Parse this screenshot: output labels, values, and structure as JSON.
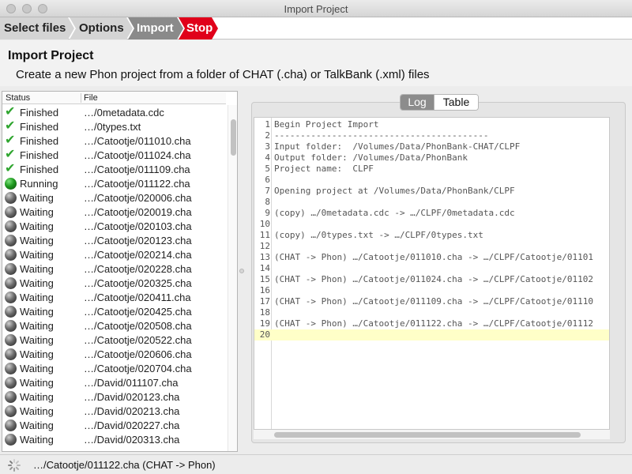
{
  "window": {
    "title": "Import Project"
  },
  "steps": [
    {
      "label": "Select files"
    },
    {
      "label": "Options"
    },
    {
      "label": "Import"
    },
    {
      "label": "Stop"
    }
  ],
  "header": {
    "title": "Import Project",
    "description": "Create a new Phon project from a folder of CHAT (.cha) or TalkBank (.xml) files"
  },
  "task_table": {
    "columns": [
      "Status",
      "File"
    ],
    "rows": [
      {
        "status": "Finished",
        "file": "…/0metadata.cdc"
      },
      {
        "status": "Finished",
        "file": "…/0types.txt"
      },
      {
        "status": "Finished",
        "file": "…/Catootje/011010.cha"
      },
      {
        "status": "Finished",
        "file": "…/Catootje/011024.cha"
      },
      {
        "status": "Finished",
        "file": "…/Catootje/011109.cha"
      },
      {
        "status": "Running",
        "file": "…/Catootje/011122.cha"
      },
      {
        "status": "Waiting",
        "file": "…/Catootje/020006.cha"
      },
      {
        "status": "Waiting",
        "file": "…/Catootje/020019.cha"
      },
      {
        "status": "Waiting",
        "file": "…/Catootje/020103.cha"
      },
      {
        "status": "Waiting",
        "file": "…/Catootje/020123.cha"
      },
      {
        "status": "Waiting",
        "file": "…/Catootje/020214.cha"
      },
      {
        "status": "Waiting",
        "file": "…/Catootje/020228.cha"
      },
      {
        "status": "Waiting",
        "file": "…/Catootje/020325.cha"
      },
      {
        "status": "Waiting",
        "file": "…/Catootje/020411.cha"
      },
      {
        "status": "Waiting",
        "file": "…/Catootje/020425.cha"
      },
      {
        "status": "Waiting",
        "file": "…/Catootje/020508.cha"
      },
      {
        "status": "Waiting",
        "file": "…/Catootje/020522.cha"
      },
      {
        "status": "Waiting",
        "file": "…/Catootje/020606.cha"
      },
      {
        "status": "Waiting",
        "file": "…/Catootje/020704.cha"
      },
      {
        "status": "Waiting",
        "file": "…/David/011107.cha"
      },
      {
        "status": "Waiting",
        "file": "…/David/020123.cha"
      },
      {
        "status": "Waiting",
        "file": "…/David/020213.cha"
      },
      {
        "status": "Waiting",
        "file": "…/David/020227.cha"
      },
      {
        "status": "Waiting",
        "file": "…/David/020313.cha"
      }
    ]
  },
  "log_tabs": [
    {
      "label": "Log",
      "selected": true
    },
    {
      "label": "Table",
      "selected": false
    }
  ],
  "log_lines": [
    {
      "n": "1",
      "text": "Begin Project Import"
    },
    {
      "n": "2",
      "text": "-----------------------------------------"
    },
    {
      "n": "3",
      "text": "Input folder:  /Volumes/Data/PhonBank-CHAT/CLPF"
    },
    {
      "n": "4",
      "text": "Output folder: /Volumes/Data/PhonBank"
    },
    {
      "n": "5",
      "text": "Project name:  CLPF"
    },
    {
      "n": "6",
      "text": ""
    },
    {
      "n": "7",
      "text": "Opening project at /Volumes/Data/PhonBank/CLPF"
    },
    {
      "n": "8",
      "text": ""
    },
    {
      "n": "9",
      "text": "(copy) …/0metadata.cdc -> …/CLPF/0metadata.cdc"
    },
    {
      "n": "10",
      "text": ""
    },
    {
      "n": "11",
      "text": "(copy) …/0types.txt -> …/CLPF/0types.txt"
    },
    {
      "n": "12",
      "text": ""
    },
    {
      "n": "13",
      "text": "(CHAT -> Phon) …/Catootje/011010.cha -> …/CLPF/Catootje/01101"
    },
    {
      "n": "14",
      "text": ""
    },
    {
      "n": "15",
      "text": "(CHAT -> Phon) …/Catootje/011024.cha -> …/CLPF/Catootje/01102"
    },
    {
      "n": "16",
      "text": ""
    },
    {
      "n": "17",
      "text": "(CHAT -> Phon) …/Catootje/011109.cha -> …/CLPF/Catootje/01110"
    },
    {
      "n": "18",
      "text": ""
    },
    {
      "n": "19",
      "text": "(CHAT -> Phon) …/Catootje/011122.cha -> …/CLPF/Catootje/01112"
    },
    {
      "n": "20",
      "text": ""
    }
  ],
  "active_log_line": 20,
  "statusbar": {
    "text": "…/Catootje/011122.cha (CHAT -> Phon)"
  },
  "colors": {
    "stop": "#e0001a",
    "current_step": "#8a8a8a",
    "finished": "#2fa52f",
    "running": "#1f9a1f",
    "waiting": "#3a3a3a",
    "active_line": "#ffffc8"
  }
}
